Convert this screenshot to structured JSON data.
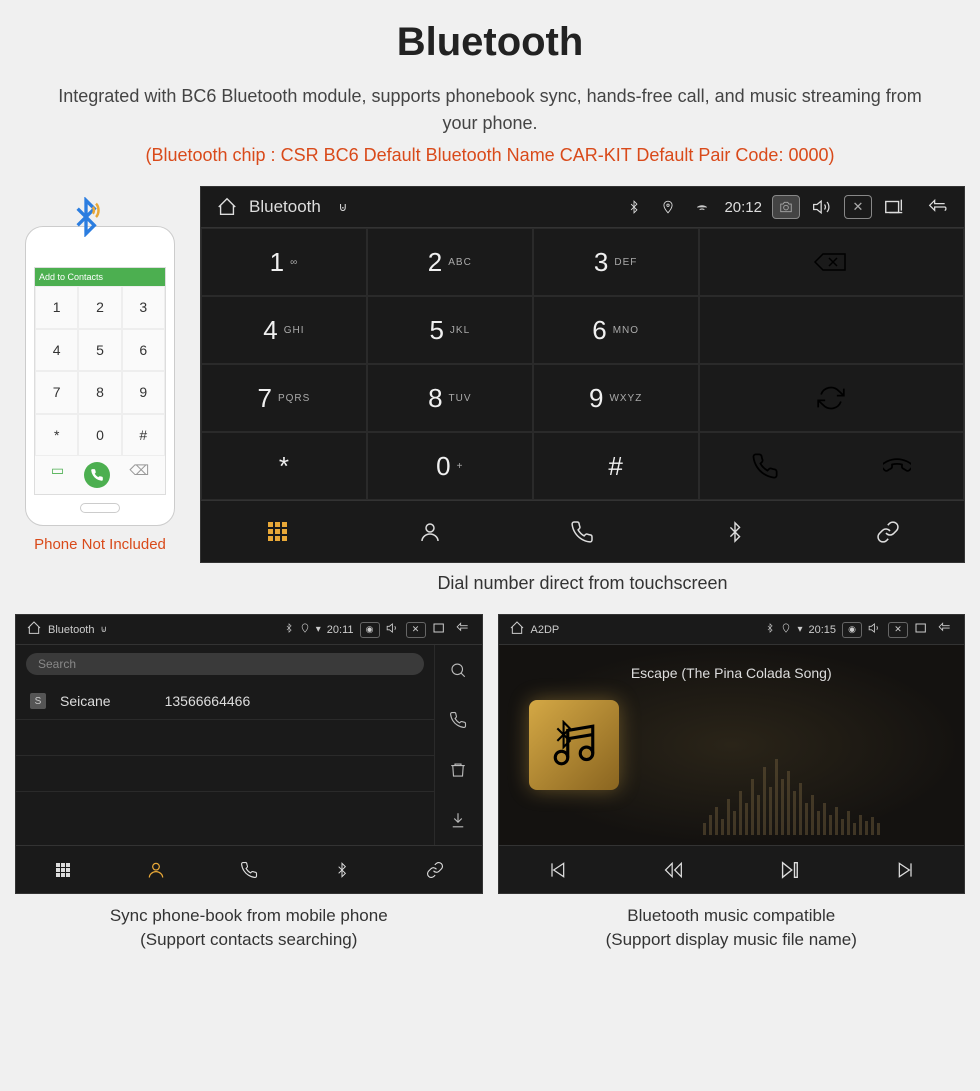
{
  "title": "Bluetooth",
  "description": "Integrated with BC6 Bluetooth module, supports phonebook sync, hands-free call, and music streaming from your phone.",
  "specs": "(Bluetooth chip : CSR BC6     Default Bluetooth Name CAR-KIT     Default Pair Code: 0000)",
  "phone": {
    "header": "Add to Contacts",
    "caption": "Phone Not Included"
  },
  "dialer": {
    "bar_title": "Bluetooth",
    "time": "20:12",
    "keys": [
      {
        "digit": "1",
        "letters": "∞"
      },
      {
        "digit": "2",
        "letters": "ABC"
      },
      {
        "digit": "3",
        "letters": "DEF"
      },
      {
        "digit": "4",
        "letters": "GHI"
      },
      {
        "digit": "5",
        "letters": "JKL"
      },
      {
        "digit": "6",
        "letters": "MNO"
      },
      {
        "digit": "7",
        "letters": "PQRS"
      },
      {
        "digit": "8",
        "letters": "TUV"
      },
      {
        "digit": "9",
        "letters": "WXYZ"
      },
      {
        "digit": "*",
        "letters": ""
      },
      {
        "digit": "0",
        "letters": "+"
      },
      {
        "digit": "#",
        "letters": ""
      }
    ],
    "caption": "Dial number direct from touchscreen"
  },
  "contacts": {
    "bar_title": "Bluetooth",
    "time": "20:11",
    "search_placeholder": "Search",
    "items": [
      {
        "badge": "S",
        "name": "Seicane",
        "number": "13566664466"
      }
    ],
    "caption_line1": "Sync phone-book from mobile phone",
    "caption_line2": "(Support contacts searching)"
  },
  "music": {
    "bar_title": "A2DP",
    "time": "20:15",
    "song": "Escape (The Pina Colada Song)",
    "caption_line1": "Bluetooth music compatible",
    "caption_line2": "(Support display music file name)"
  }
}
